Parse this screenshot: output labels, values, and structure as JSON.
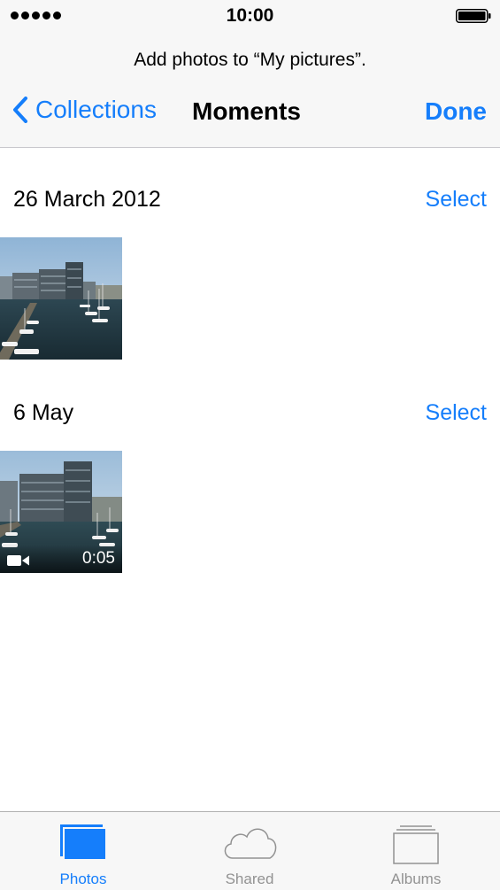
{
  "status_bar": {
    "time": "10:00",
    "signal_bars": 5
  },
  "header": {
    "prompt": "Add photos to “My pictures”.",
    "back_label": "Collections",
    "title": "Moments",
    "done_label": "Done"
  },
  "moments": [
    {
      "date": "26 March 2012",
      "select_label": "Select",
      "items": [
        {
          "type": "photo"
        }
      ]
    },
    {
      "date": "6 May",
      "select_label": "Select",
      "items": [
        {
          "type": "video",
          "duration": "0:05"
        }
      ]
    }
  ],
  "tabs": [
    {
      "label": "Photos",
      "icon": "photos-icon",
      "active": true
    },
    {
      "label": "Shared",
      "icon": "cloud-icon",
      "active": false
    },
    {
      "label": "Albums",
      "icon": "albums-icon",
      "active": false
    }
  ],
  "colors": {
    "accent": "#157efb",
    "inactive": "#929292",
    "bar_background": "#f7f7f7"
  }
}
